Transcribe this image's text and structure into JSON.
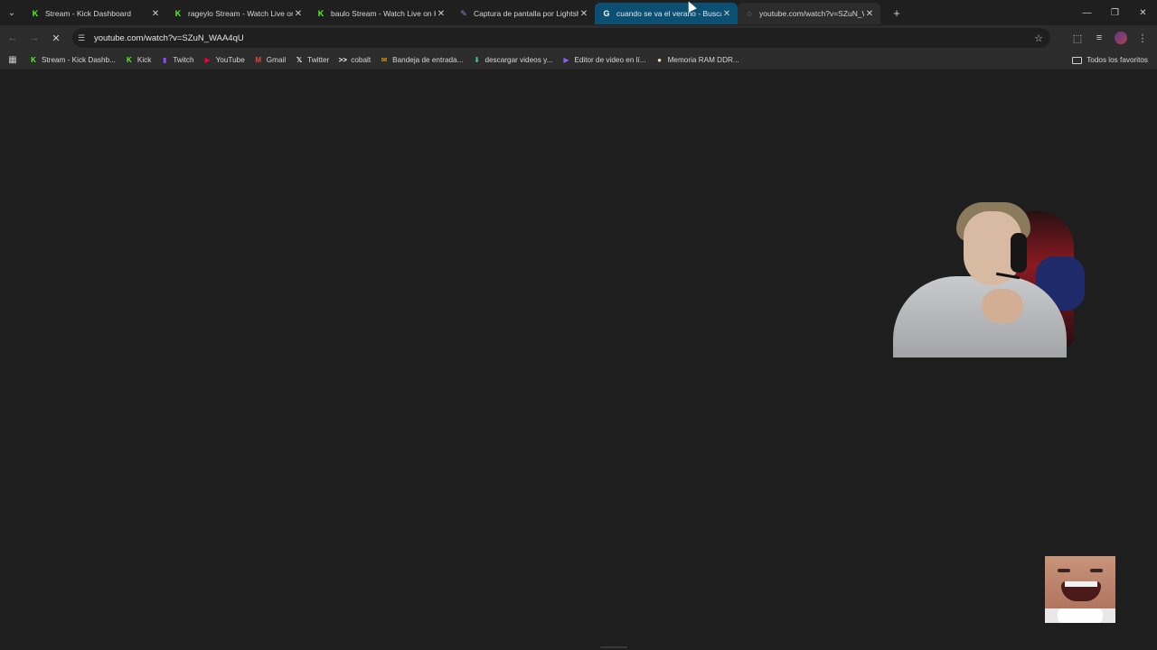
{
  "tabs": [
    {
      "title": "Stream - Kick Dashboard",
      "favicon": "K",
      "color": "#53fc18",
      "state": "normal"
    },
    {
      "title": "rageylo Stream - Watch Live on",
      "favicon": "K",
      "color": "#53fc18",
      "state": "normal"
    },
    {
      "title": "baulo Stream - Watch Live on K",
      "favicon": "K",
      "color": "#53fc18",
      "state": "normal"
    },
    {
      "title": "Captura de pantalla por Lightsh",
      "favicon": "✎",
      "color": "#9b7ee6",
      "state": "normal"
    },
    {
      "title": "cuando se va el verano - Busca",
      "favicon": "G",
      "color": "#ffffff",
      "state": "hovered"
    },
    {
      "title": "youtube.com/watch?v=SZuN_W",
      "favicon": "◌",
      "color": "#cfcfcf",
      "state": "active"
    }
  ],
  "tab_close_glyph": "✕",
  "new_tab_glyph": "+",
  "window": {
    "minimize": "—",
    "restore": "❐",
    "close": "✕"
  },
  "toolbar": {
    "url": "youtube.com/watch?v=SZuN_WAA4qU",
    "back": "←",
    "forward": "→",
    "reload": "✕",
    "site_info": "☰",
    "star": "☆",
    "extensions": "⬚",
    "media": "≡",
    "menu": "⋮"
  },
  "bookmarks": [
    {
      "label": "Stream - Kick Dashb...",
      "icon": "K",
      "color": "#53fc18"
    },
    {
      "label": "Kick",
      "icon": "K",
      "color": "#53fc18"
    },
    {
      "label": "Twitch",
      "icon": "▮",
      "color": "#9146ff"
    },
    {
      "label": "YouTube",
      "icon": "▶",
      "color": "#ff0033"
    },
    {
      "label": "Gmail",
      "icon": "M",
      "color": "#ea4335"
    },
    {
      "label": "Twitter",
      "icon": "𝕏",
      "color": "#ffffff"
    },
    {
      "label": "cobalt",
      "icon": ">>",
      "color": "#ffffff"
    },
    {
      "label": "Bandeja de entrada...",
      "icon": "✉",
      "color": "#f6b400"
    },
    {
      "label": "descargar videos y...",
      "icon": "⬇",
      "color": "#38c9a0"
    },
    {
      "label": "Editor de video en lí...",
      "icon": "▶",
      "color": "#8b5cf6"
    },
    {
      "label": "Memoria RAM DDR...",
      "icon": "●",
      "color": "#f0e6b4"
    }
  ],
  "all_bookmarks": "Todos los favoritos"
}
